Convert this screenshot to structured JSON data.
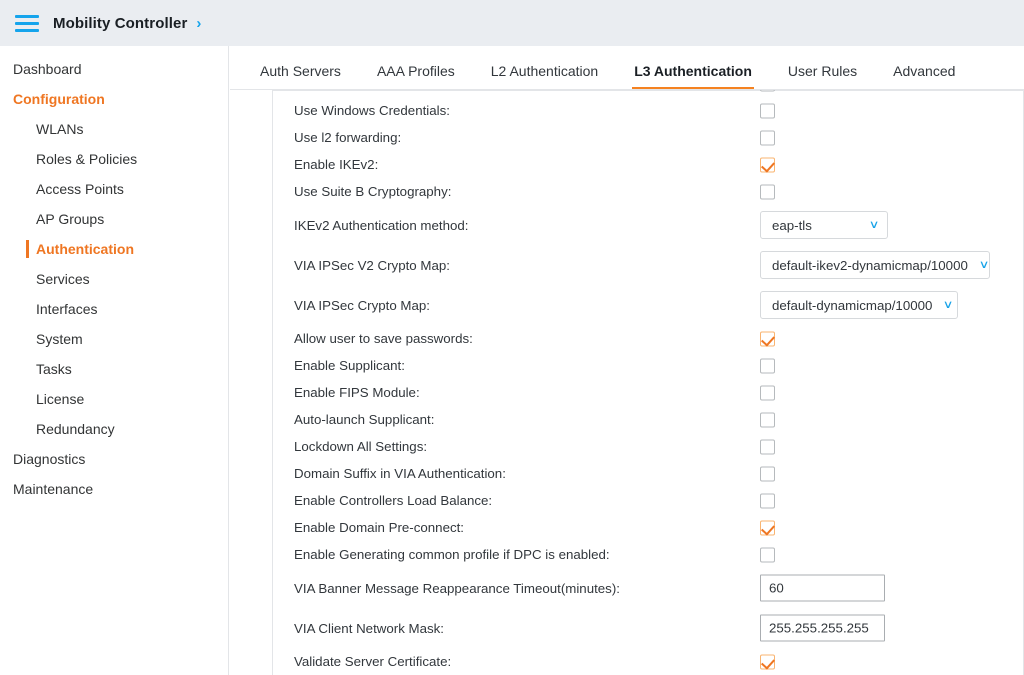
{
  "topbar": {
    "menu_icon": "hamburger-icon",
    "title": "Mobility Controller",
    "chevron": "›"
  },
  "sidebar": {
    "items": [
      {
        "label": "Dashboard",
        "level": "top",
        "active": false
      },
      {
        "label": "Configuration",
        "level": "section",
        "active": false
      },
      {
        "label": "WLANs",
        "level": "child",
        "active": false
      },
      {
        "label": "Roles & Policies",
        "level": "child",
        "active": false
      },
      {
        "label": "Access Points",
        "level": "child",
        "active": false
      },
      {
        "label": "AP Groups",
        "level": "child",
        "active": false
      },
      {
        "label": "Authentication",
        "level": "child",
        "active": true
      },
      {
        "label": "Services",
        "level": "child",
        "active": false
      },
      {
        "label": "Interfaces",
        "level": "child",
        "active": false
      },
      {
        "label": "System",
        "level": "child",
        "active": false
      },
      {
        "label": "Tasks",
        "level": "child",
        "active": false
      },
      {
        "label": "License",
        "level": "child",
        "active": false
      },
      {
        "label": "Redundancy",
        "level": "child",
        "active": false
      },
      {
        "label": "Diagnostics",
        "level": "top",
        "active": false
      },
      {
        "label": "Maintenance",
        "level": "top",
        "active": false
      }
    ]
  },
  "tabs": [
    {
      "label": "Auth Servers",
      "active": false
    },
    {
      "label": "AAA Profiles",
      "active": false
    },
    {
      "label": "L2 Authentication",
      "active": false
    },
    {
      "label": "L3 Authentication",
      "active": true
    },
    {
      "label": "User Rules",
      "active": false
    },
    {
      "label": "Advanced",
      "active": false
    }
  ],
  "form": {
    "rows": [
      {
        "label": "",
        "type": "checkbox",
        "checked": false,
        "partial": true
      },
      {
        "label": "Use Windows Credentials:",
        "type": "checkbox",
        "checked": false
      },
      {
        "label": "Use l2 forwarding:",
        "type": "checkbox",
        "checked": false
      },
      {
        "label": "Enable IKEv2:",
        "type": "checkbox",
        "checked": true
      },
      {
        "label": "Use Suite B Cryptography:",
        "type": "checkbox",
        "checked": false
      },
      {
        "label": "IKEv2 Authentication method:",
        "type": "select",
        "value": "eap-tls",
        "width": "w-sm"
      },
      {
        "label": "VIA IPSec V2 Crypto Map:",
        "type": "select",
        "value": "default-ikev2-dynamicmap/10000",
        "width": "w-lg"
      },
      {
        "label": "VIA IPSec Crypto Map:",
        "type": "select",
        "value": "default-dynamicmap/10000",
        "width": "w-md"
      },
      {
        "label": "Allow user to save passwords:",
        "type": "checkbox",
        "checked": true
      },
      {
        "label": "Enable Supplicant:",
        "type": "checkbox",
        "checked": false
      },
      {
        "label": "Enable FIPS Module:",
        "type": "checkbox",
        "checked": false
      },
      {
        "label": "Auto-launch Supplicant:",
        "type": "checkbox",
        "checked": false
      },
      {
        "label": "Lockdown All Settings:",
        "type": "checkbox",
        "checked": false
      },
      {
        "label": "Domain Suffix in VIA Authentication:",
        "type": "checkbox",
        "checked": false
      },
      {
        "label": "Enable Controllers Load Balance:",
        "type": "checkbox",
        "checked": false
      },
      {
        "label": "Enable Domain Pre-connect:",
        "type": "checkbox",
        "checked": true
      },
      {
        "label": "Enable Generating common profile if DPC is enabled:",
        "type": "checkbox",
        "checked": false
      },
      {
        "label": "VIA Banner Message Reappearance Timeout(minutes):",
        "type": "text",
        "value": "60"
      },
      {
        "label": "VIA Client Network Mask:",
        "type": "text",
        "value": "255.255.255.255"
      },
      {
        "label": "Validate Server Certificate:",
        "type": "checkbox",
        "checked": true
      }
    ]
  },
  "colors": {
    "accent_orange": "#ef7622",
    "tab_underline": "#f58220",
    "link_blue": "#15a4ec",
    "header_bg": "#eaedf1",
    "text": "#32373c"
  }
}
